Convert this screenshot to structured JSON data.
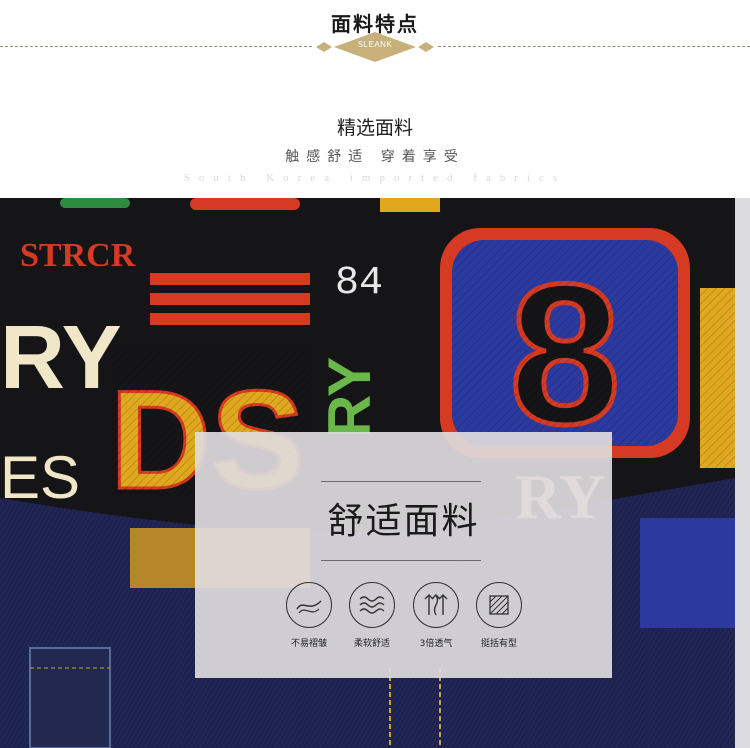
{
  "header": {
    "section_title": "面料特点",
    "badge": "SLEANK",
    "subtitle": "精选面料",
    "tagline": "触感舒适  穿着享受",
    "english": "South Korea imported fabrics"
  },
  "photo": {
    "print_texts": [
      "STRCR",
      "84",
      "RY",
      "DS",
      "8",
      "ES",
      "RY"
    ]
  },
  "panel": {
    "title": "舒适面料",
    "features": [
      {
        "icon": "wrinkle-wave-icon",
        "label": "不易褶皱"
      },
      {
        "icon": "soft-waves-icon",
        "label": "柔软舒适"
      },
      {
        "icon": "breathable-arrows-icon",
        "label": "3倍透气"
      },
      {
        "icon": "shape-hatch-icon",
        "label": "挺括有型"
      }
    ]
  },
  "colors": {
    "accent_gold": "#c7b07a",
    "fabric_navy": "#1d2250",
    "print_red": "#d63a22",
    "print_yellow": "#e0a81e",
    "print_blue": "#2c3aa0"
  }
}
